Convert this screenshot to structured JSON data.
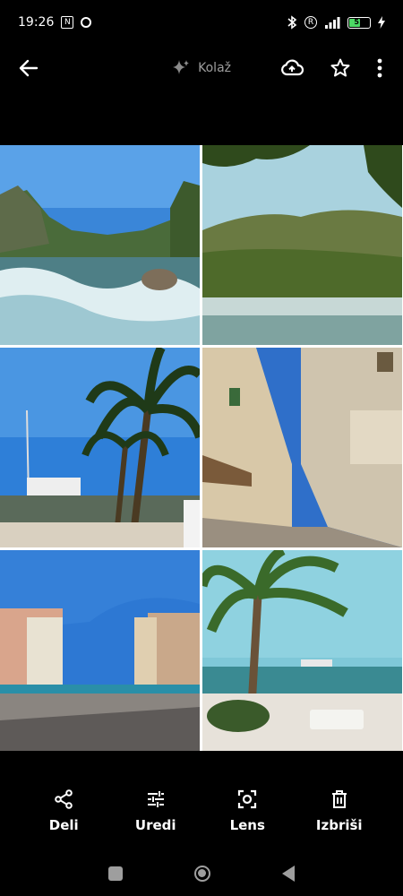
{
  "status": {
    "time": "19:26",
    "battery": "51"
  },
  "toolbar": {
    "collage_label": "Kolaž"
  },
  "actions": [
    {
      "label": "Deli",
      "icon": "share-icon"
    },
    {
      "label": "Uredi",
      "icon": "tune-icon"
    },
    {
      "label": "Lens",
      "icon": "lens-icon"
    },
    {
      "label": "Izbriši",
      "icon": "trash-icon"
    }
  ],
  "photos": [
    {
      "name": "waterfall-river",
      "colors": [
        "#3a86d8",
        "#e6f0f4",
        "#3f6b3a"
      ]
    },
    {
      "name": "river-cliffs",
      "colors": [
        "#a9d2de",
        "#5f7a3b",
        "#c7d8d6"
      ]
    },
    {
      "name": "palm-promenade",
      "colors": [
        "#2e7fd8",
        "#1f3a18",
        "#d9d0c0"
      ]
    },
    {
      "name": "stone-alley",
      "colors": [
        "#2f6fc9",
        "#d8c8a8",
        "#6a5a40"
      ]
    },
    {
      "name": "square-buildings",
      "colors": [
        "#2d78d3",
        "#d9a58c",
        "#8a8580"
      ]
    },
    {
      "name": "palm-seafront",
      "colors": [
        "#7fc8d8",
        "#3a6a2a",
        "#e7e2da"
      ]
    }
  ]
}
